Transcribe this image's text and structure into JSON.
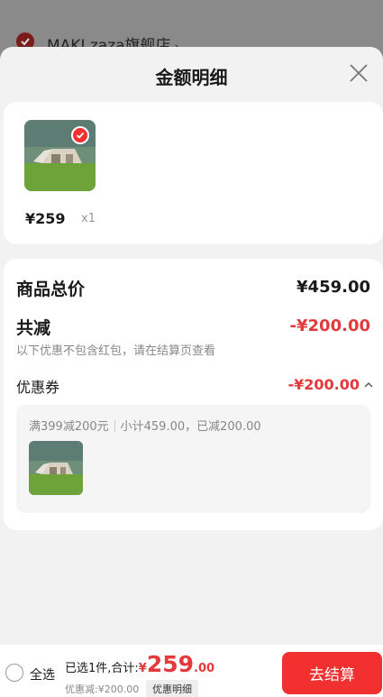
{
  "background": {
    "shop_name": "MAKI zaza旗舰店",
    "chevron": "›"
  },
  "sheet": {
    "title": "金额明细",
    "close_icon": "close-icon"
  },
  "items_card": {
    "items": [
      {
        "price": "¥259",
        "qty": "x1",
        "selected": true,
        "image": "tent-on-grass-thumbnail"
      }
    ]
  },
  "detail": {
    "total_label": "商品总价",
    "total_value": "¥459.00",
    "reduce_label": "共减",
    "reduce_value": "-¥200.00",
    "reduce_note": "以下优惠不包含红包，请在结算页查看",
    "coupon_label": "优惠券",
    "coupon_value": "-¥200.00",
    "coupon_rule": "满399减200元",
    "coupon_subtotal": "小计459.00，已减200.00"
  },
  "bottom_bar": {
    "select_all_label": "全选",
    "summary_prefix": "已选1件,合计:",
    "currency": "¥",
    "amount_int": "259",
    "amount_dec": ".00",
    "discount_text": "优惠减:¥200.00",
    "detail_button": "优惠明细",
    "checkout_button": "去结算"
  },
  "colors": {
    "accent": "#f23030",
    "price_red": "#e4393c",
    "sheet_bg": "#f2f2f2",
    "overlay": "#7f7f7f"
  }
}
